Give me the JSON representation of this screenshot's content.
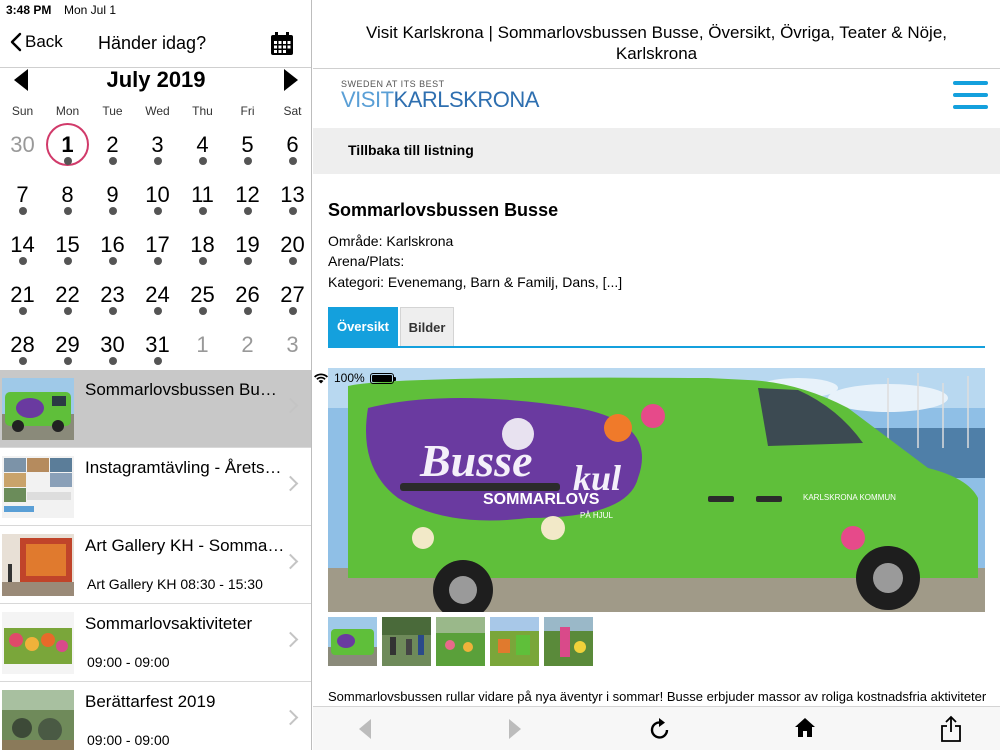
{
  "status_bar": {
    "time": "3:48 PM",
    "date": "Mon Jul 1",
    "battery": "100%"
  },
  "left_nav": {
    "back_label": "Back",
    "title": "Händer idag?"
  },
  "calendar": {
    "month": "July 2019",
    "weekdays": [
      "Sun",
      "Mon",
      "Tue",
      "Wed",
      "Thu",
      "Fri",
      "Sat"
    ],
    "days": [
      {
        "n": "30",
        "other": true,
        "dot": false
      },
      {
        "n": "1",
        "today": true,
        "dot": true
      },
      {
        "n": "2",
        "dot": true
      },
      {
        "n": "3",
        "dot": true
      },
      {
        "n": "4",
        "dot": true
      },
      {
        "n": "5",
        "dot": true
      },
      {
        "n": "6",
        "dot": true
      },
      {
        "n": "7",
        "dot": true
      },
      {
        "n": "8",
        "dot": true
      },
      {
        "n": "9",
        "dot": true
      },
      {
        "n": "10",
        "dot": true
      },
      {
        "n": "11",
        "dot": true
      },
      {
        "n": "12",
        "dot": true
      },
      {
        "n": "13",
        "dot": true
      },
      {
        "n": "14",
        "dot": true
      },
      {
        "n": "15",
        "dot": true
      },
      {
        "n": "16",
        "dot": true
      },
      {
        "n": "17",
        "dot": true
      },
      {
        "n": "18",
        "dot": true
      },
      {
        "n": "19",
        "dot": true
      },
      {
        "n": "20",
        "dot": true
      },
      {
        "n": "21",
        "dot": true
      },
      {
        "n": "22",
        "dot": true
      },
      {
        "n": "23",
        "dot": true
      },
      {
        "n": "24",
        "dot": true
      },
      {
        "n": "25",
        "dot": true
      },
      {
        "n": "26",
        "dot": true
      },
      {
        "n": "27",
        "dot": true
      },
      {
        "n": "28",
        "dot": true
      },
      {
        "n": "29",
        "dot": true
      },
      {
        "n": "30",
        "dot": true
      },
      {
        "n": "31",
        "dot": true
      },
      {
        "n": "1",
        "other": true,
        "dot": false
      },
      {
        "n": "2",
        "other": true,
        "dot": false
      },
      {
        "n": "3",
        "other": true,
        "dot": false
      }
    ]
  },
  "events": [
    {
      "title": "Sommarlovsbussen Busse, Översikt, Övriga, Teater & Nöje, Karlskrona",
      "subtitle": "",
      "selected": true
    },
    {
      "title": "Instagramtävling - Årets bästa bild",
      "subtitle": "",
      "selected": false
    },
    {
      "title": "Art Gallery KH - Sommarutställning",
      "subtitle": "Art Gallery KH 08:30 - 15:30",
      "selected": false
    },
    {
      "title": "Sommarlovsaktiviteter",
      "subtitle": "09:00 - 09:00",
      "selected": false
    },
    {
      "title": "Berättarfest 2019",
      "subtitle": "09:00 - 09:00",
      "selected": false
    }
  ],
  "detail": {
    "page_title": "Visit Karlskrona | Sommarlovsbussen Busse, Översikt, Övriga, Teater & Nöje, Karlskrona",
    "brand_tagline": "SWEDEN AT ITS BEST",
    "brand_logo_visit": "VISIT",
    "brand_logo_name": "KARLSKRONA",
    "back_to_list": "Tillbaka till listning",
    "heading": "Sommarlovsbussen Busse",
    "area": "Område: Karlskrona",
    "venue": "Arena/Plats:",
    "category": "Kategori: Evenemang, Barn & Familj, Dans, [...]",
    "tabs": [
      "Översikt",
      "Bilder"
    ],
    "description": "Sommarlovsbussen rullar vidare på nya äventyr i sommar! Busse erbjuder massor av roliga kostnadsfria aktiviteter",
    "van_text_main": "Busse",
    "van_text_kul": "kul",
    "van_text_sub": "SOMMARLOVS",
    "van_text_pahjul": "PÅ HJUL",
    "van_text_kommun": "KARLSKRONA KOMMUN"
  },
  "colors": {
    "accent": "#14a0dd",
    "today_ring": "#d13a6a",
    "selected_row": "#c8c8c8",
    "van_green": "#5fbf3a"
  }
}
